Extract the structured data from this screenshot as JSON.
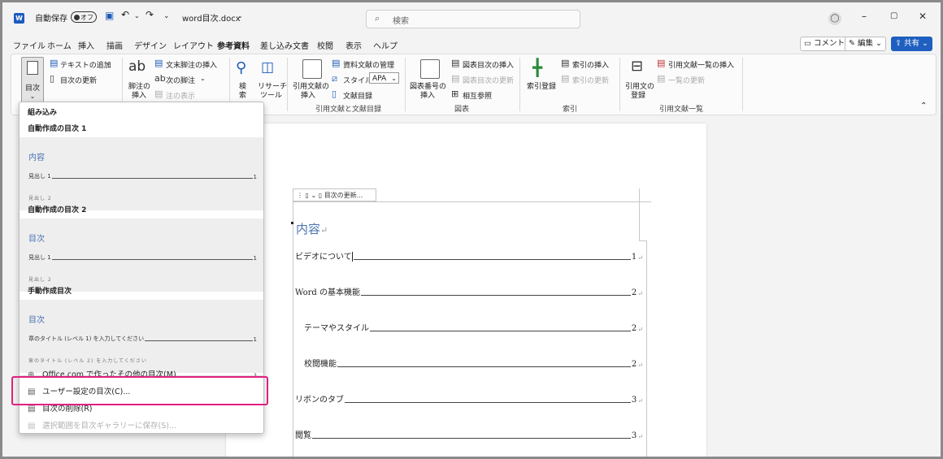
{
  "titlebar": {
    "autosave_label": "自動保存",
    "autosave_state": "オフ",
    "filename": "word目次.docx",
    "search_placeholder": "検索"
  },
  "tabs": [
    "ファイル",
    "ホーム",
    "挿入",
    "描画",
    "デザイン",
    "レイアウト",
    "参考資料",
    "差し込み文書",
    "校閲",
    "表示",
    "ヘルプ"
  ],
  "active_tab": "参考資料",
  "ribbon_buttons": {
    "comment": "コメント",
    "edit": "編集",
    "share": "共有"
  },
  "ribbon": {
    "toc": {
      "label": "目次",
      "add_text": "テキストの追加",
      "update_toc": "目次の更新"
    },
    "footnote": {
      "big": "ab",
      "insert": "脚注の挿入",
      "insert_l1": "脚注の",
      "insert_l2": "挿入",
      "endnote": "文末脚注の挿入",
      "next": "次の脚注",
      "show": "注の表示"
    },
    "research": {
      "search": "検索",
      "search_l1": "検",
      "search_l2": "索",
      "researcher": "リサーチ ツール",
      "researcher_l1": "リサーチ",
      "researcher_l2": "ツール"
    },
    "citations": {
      "insert": "引用文献の挿入",
      "insert_l1": "引用文献の",
      "insert_l2": "挿入",
      "manage": "資料文献の管理",
      "style_label": "スタイル:",
      "style_value": "APA",
      "bibliography": "文献目録",
      "group": "引用文献と文献目録"
    },
    "captions": {
      "insert": "図表番号の挿入",
      "insert_l1": "図表番号の",
      "insert_l2": "挿入",
      "table_of_figures": "図表目次の挿入",
      "update": "図表目次の更新",
      "cross_ref": "相互参照",
      "group": "図表"
    },
    "index": {
      "mark": "索引登録",
      "insert": "索引の挿入",
      "update": "索引の更新",
      "group": "索引"
    },
    "authorities": {
      "mark": "引用文の登録",
      "mark_l1": "引用文の",
      "mark_l2": "登録",
      "insert": "引用文献一覧の挿入",
      "update": "一覧の更新",
      "group": "引用文献一覧"
    }
  },
  "gallery": {
    "builtin_header": "組み込み",
    "auto1": {
      "name": "自動作成の目次 1",
      "title": "内容",
      "line": "見出し 1",
      "page": "1",
      "cut": "見出し 2"
    },
    "auto2": {
      "name": "自動作成の目次 2",
      "title": "目次",
      "line": "見出し 1",
      "page": "1",
      "cut": "見出し 2"
    },
    "manual": {
      "name": "手動作成目次",
      "title": "目次",
      "line": "章のタイトル (レベル 1) を入力してください",
      "page": "1",
      "cut": "章のタイトル (レベル 2) を入力してください"
    },
    "menu": [
      {
        "label": "Office.com で作ったその他の目次(M)",
        "enabled": true
      },
      {
        "label": "ユーザー設定の目次(C)...",
        "enabled": true
      },
      {
        "label": "目次の削除(R)",
        "enabled": true
      },
      {
        "label": "選択範囲を目次ギャラリーに保存(S)...",
        "enabled": false
      }
    ]
  },
  "document": {
    "toc_bar_label": "目次の更新...",
    "toc_heading": "内容",
    "entries": [
      {
        "text": "ビデオについて",
        "page": "1",
        "indent": 0
      },
      {
        "text": "Word の基本機能",
        "page": "2",
        "indent": 0
      },
      {
        "text": "テーマやスタイル",
        "page": "2",
        "indent": 1
      },
      {
        "text": "校閲機能",
        "page": "2",
        "indent": 1
      },
      {
        "text": "リボンのタブ",
        "page": "3",
        "indent": 0
      },
      {
        "text": "閲覧",
        "page": "3",
        "indent": 0
      }
    ]
  },
  "colors": {
    "accent": "#1e5bb8",
    "highlight": "#e0207f",
    "heading": "#4a73b3"
  }
}
